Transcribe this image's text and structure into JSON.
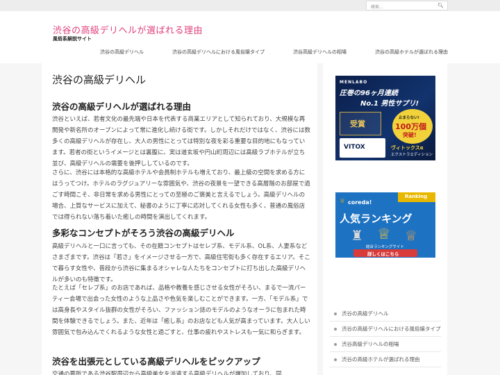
{
  "topbar": {
    "search_placeholder": "検索...",
    "search_icon": "search-icon"
  },
  "header": {
    "site_title": "渋谷の高級デリヘルが選ばれる理由",
    "site_subtitle": "風俗系解説サイト",
    "nav": [
      "渋谷の高級デリヘル",
      "渋谷の高級デリヘルにおける風俗嬢タイプ",
      "渋谷高級デリヘルの相場",
      "渋谷の高級ホテルが選ばれる理由"
    ]
  },
  "main": {
    "page_title": "渋谷の高級デリヘル",
    "sections": [
      {
        "heading": "渋谷の高級デリヘルが選ばれる理由",
        "paragraphs": [
          "渋谷といえば、若者文化の最先端や日本を代表する商業エリアとして知られており、大規模な再開発や新名所のオープンによって常に進化し続ける街です。しかしそれだけではなく、渋谷には数多くの高級デリヘルが存在し、大人の男性にとっては特別な夜を彩る重要な目的地にもなっています。若者の街というイメージとは裏腹に、実は道玄坂や円山町周辺には高級ラブホテルが立ち並び、高級デリヘルの需要を後押ししているのです。",
          "さらに、渋谷には本格的な高級ホテルや会員制ホテルも増えており、最上級の空間を求める方にはうってつけ。ホテルのラグジュアリーな雰囲気や、渋谷の夜景を一望できる高層階のお部屋で過ごす時間こそ、非日常を求める男性にとっての至極のご褒美と言えるでしょう。高級デリヘルの場合、上質なサービスに加えて、秘書のように丁寧に応対してくれる女性も多く、普通の風俗店では得られない落ち着いた癒しの時間を演出してくれます。"
        ]
      },
      {
        "heading": "多彩なコンセプトがそろう渋谷の高級デリヘル",
        "paragraphs": [
          "高級デリヘルと一口に言っても、その在籍コンセプトはセレブ系、モデル系、OL系、人妻系などさまざまです。渋谷は「若さ」をイメージさせる一方で、高級住宅街も多く存在するエリア。そこで暮らす女性や、普段から渋谷に集まるオシャレな人たちをコンセプトに打ち出した高級デリヘルが多いのも特徴です。",
          "たとえば「セレブ系」のお店であれば、品格や教養を感じさせる女性がそろい、まるで一流パーティー会場で出会った女性のような上品さや色気を楽しむことができます。一方、「モデル系」では高身長やスタイル抜群の女性がそろい、ファッション誌のモデルのようなオーラに包まれた時間を体験できるでしょう。また、近年は「癒し系」のお店なども人気が高まっています。大人しい雰囲気で包み込んでくれるような女性と過ごすと、仕事の疲れやストレスも一気に和らぎます。"
        ]
      },
      {
        "heading": "渋谷を出張元としている高級デリヘルをピックアップ",
        "paragraphs": [
          "交通の要所である渋谷駅周辺から高級美女を派遣する高級デリヘルが増加しており、同"
        ]
      }
    ]
  },
  "sidebar": {
    "banner1": {
      "brand": "MENLABO",
      "headline1": "圧巻の96ヶ月連続",
      "headline2": "No.1 男性サプリ!",
      "badge1": "止まらない!",
      "badge2": "100万個",
      "badge3": "突破!",
      "award": "受賞",
      "product": "VITOX",
      "product_sub": "ヴィトックスα",
      "product_sub2": "エクストラエディション"
    },
    "banner2": {
      "brand": "coreda!",
      "ribbon": "Ranking",
      "title": "人気ランキング",
      "caption": "総合ランキングサイト",
      "button": "詳しくはこちら"
    },
    "links": [
      "渋谷の高級デリヘル",
      "渋谷の高級デリヘルにおける風俗嬢タイプ",
      "渋谷高級デリヘルの相場",
      "渋谷の高級ホテルが選ばれる理由"
    ]
  },
  "colors": {
    "accent": "#e0407c",
    "banner2_bg": "#1d72c2",
    "ribbon": "#e8b800",
    "button": "#d93b3b"
  }
}
